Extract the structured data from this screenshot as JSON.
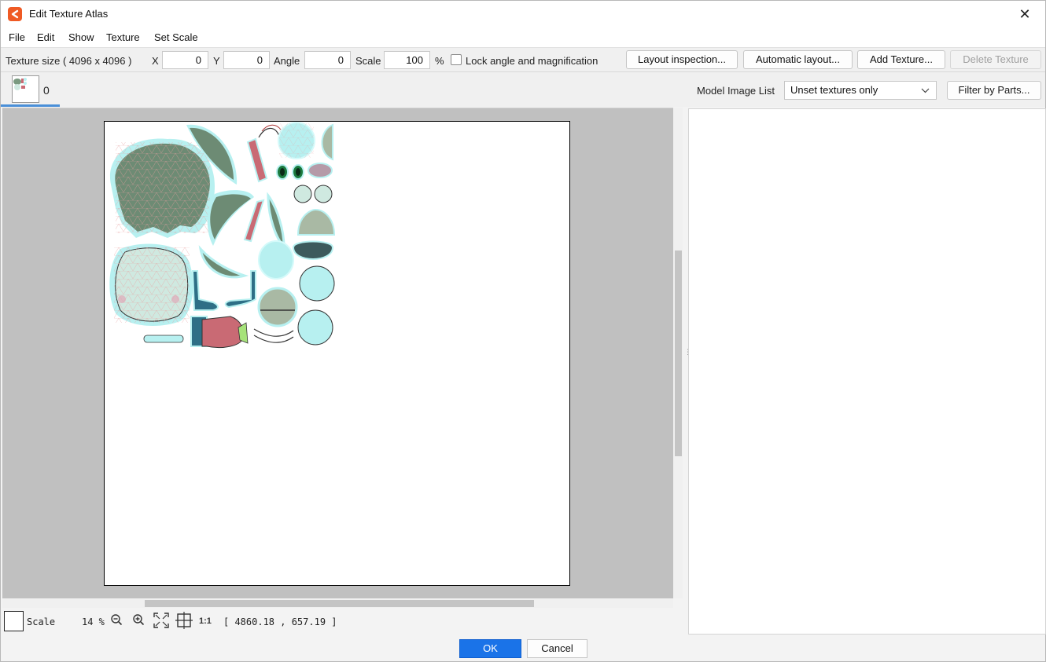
{
  "window": {
    "title": "Edit Texture Atlas",
    "close_glyph": "✕"
  },
  "menu": [
    "File",
    "Edit",
    "Show",
    "Texture",
    "Set Scale"
  ],
  "toolbar": {
    "texture_size": "Texture size ( 4096 x 4096 )",
    "x_label": "X",
    "x_value": "0",
    "y_label": "Y",
    "y_value": "0",
    "angle_label": "Angle",
    "angle_value": "0",
    "scale_label": "Scale",
    "scale_value": "100",
    "percent": "%",
    "lock_label": "Lock angle and magnification",
    "lock_checked": false,
    "layout_inspection": "Layout inspection...",
    "automatic_layout": "Automatic layout...",
    "add_texture": "Add Texture...",
    "delete_texture": "Delete Texture"
  },
  "tabs": {
    "atlas_index": "0",
    "model_image_list_label": "Model Image List",
    "model_image_select": "Unset textures only",
    "filter_button": "Filter by Parts..."
  },
  "status": {
    "scale_label": "Scale",
    "zoom_value": "14 %",
    "one_to_one": "1:1",
    "coords": "[ 4860.18 ,  657.19 ]"
  },
  "buttons": {
    "ok": "OK",
    "cancel": "Cancel"
  },
  "colors": {
    "accent": "#1a73e8",
    "app_icon": "#ef5a24",
    "hair": "#6d8b74",
    "mesh_outline": "#b7f0f0",
    "body": "#cfe9e0",
    "accessory_pink": "#c96a74",
    "dark_blue": "#2e6f86"
  }
}
